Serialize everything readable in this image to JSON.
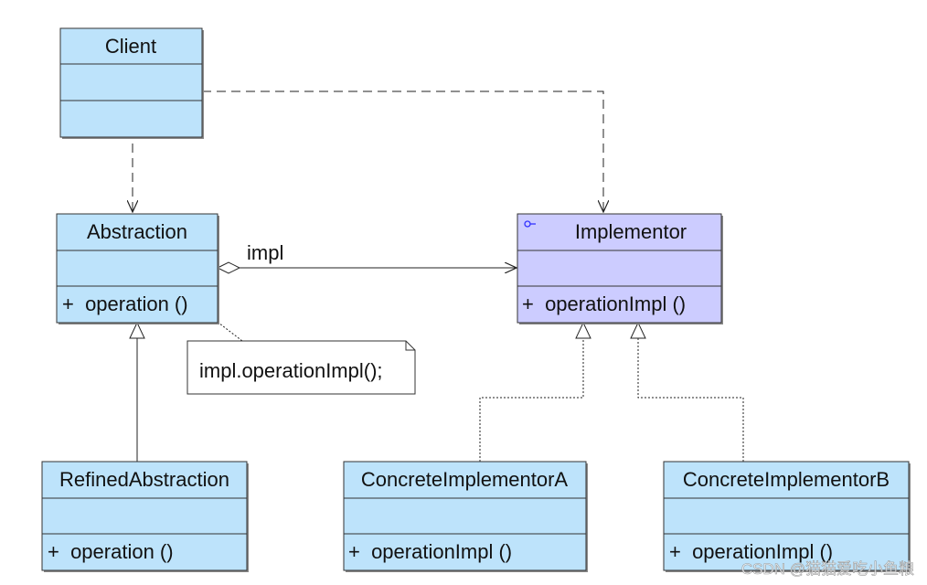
{
  "colors": {
    "class_fill": "#BDE3FB",
    "interface_fill": "#CCCCFF",
    "border": "#333333"
  },
  "classes": {
    "client": {
      "name": "Client",
      "operation": ""
    },
    "abstraction": {
      "name": "Abstraction",
      "operation": "+  operation ()"
    },
    "implementor": {
      "name": "Implementor",
      "operation": "+  operationImpl ()",
      "icon": "interface-icon"
    },
    "refined": {
      "name": "RefinedAbstraction",
      "operation": "+  operation ()"
    },
    "concrete_a": {
      "name": "ConcreteImplementorA",
      "operation": "+  operationImpl ()"
    },
    "concrete_b": {
      "name": "ConcreteImplementorB",
      "operation": "+  operationImpl ()"
    }
  },
  "association_label": "impl",
  "note": "impl.operationImpl();",
  "watermark": "CSDN @猫猫爱吃小鱼粮"
}
